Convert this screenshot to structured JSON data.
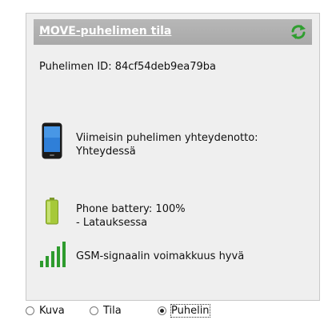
{
  "panel": {
    "title": "MOVE-puhelimen tila",
    "phone_id": "Puhelimen ID: 84cf54deb9ea79ba",
    "last_contact": {
      "line1": "Viimeisin puhelimen yhteydenotto:",
      "line2": "Yhteydessä"
    },
    "battery": {
      "line1": "Phone battery: 100%",
      "line2": "- Latauksessa",
      "level_percent": 100
    },
    "signal": {
      "text": "GSM-signaalin voimakkuus hyvä",
      "bars_lit": 5,
      "bars_total": 5
    },
    "icons": {
      "refresh": "refresh-icon",
      "phone": "phone-icon",
      "battery": "battery-icon",
      "signal": "signal-icon"
    },
    "colors": {
      "header_bg": "#b0b0b0",
      "signal_green": "#2e9b2e",
      "battery_green": "#a6c93a",
      "refresh_green": "#2f9e2f"
    }
  },
  "view_selector": {
    "options": [
      {
        "label": "Kuva",
        "checked": false
      },
      {
        "label": "Tila",
        "checked": false
      },
      {
        "label": "Puhelin",
        "checked": true
      }
    ]
  }
}
